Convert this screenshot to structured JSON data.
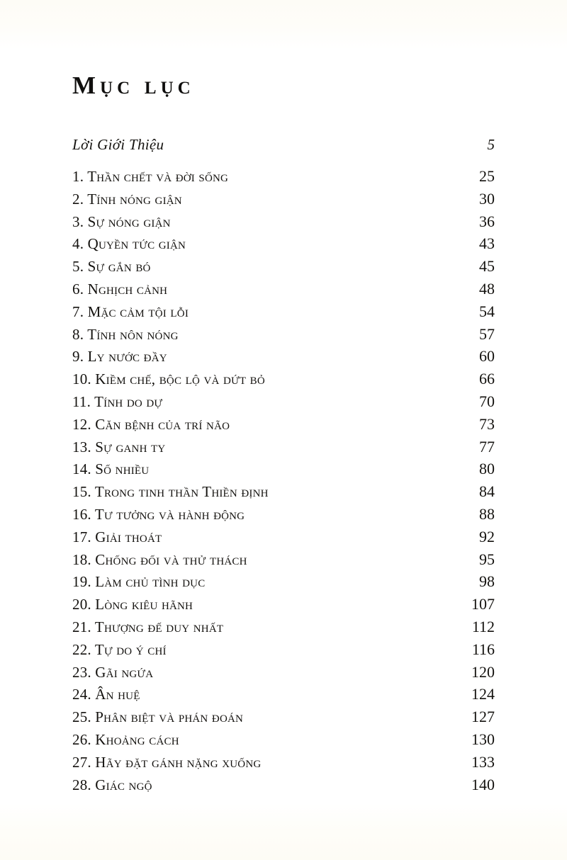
{
  "page": {
    "title": "Mục lục",
    "background_color": "#ffffff",
    "text_color": "#121110"
  },
  "toc": {
    "entries": [
      {
        "label": "Lời Giới Thiệu",
        "page": "5",
        "style": "italic"
      },
      {
        "label": "1. Thần chết và đời sống",
        "page": "25",
        "style": "small-caps"
      },
      {
        "label": "2. Tính nóng giận",
        "page": "30",
        "style": "small-caps"
      },
      {
        "label": "3. Sự nóng giận",
        "page": "36",
        "style": "small-caps"
      },
      {
        "label": "4. Quyền tức giận",
        "page": "43",
        "style": "small-caps"
      },
      {
        "label": "5. Sự gắn bó",
        "page": "45",
        "style": "small-caps"
      },
      {
        "label": "6. Nghịch cảnh",
        "page": "48",
        "style": "small-caps"
      },
      {
        "label": "7. Mặc cảm tội lỗi",
        "page": "54",
        "style": "small-caps"
      },
      {
        "label": "8. Tính nôn nóng",
        "page": "57",
        "style": "small-caps"
      },
      {
        "label": "9. Ly nước đầy",
        "page": "60",
        "style": "small-caps"
      },
      {
        "label": "10. Kiềm chế, bộc lộ và dứt bỏ",
        "page": "66",
        "style": "small-caps"
      },
      {
        "label": "11. Tính do dự",
        "page": "70",
        "style": "small-caps"
      },
      {
        "label": "12. Căn bệnh của trí não",
        "page": "73",
        "style": "small-caps"
      },
      {
        "label": "13. Sự ganh ty",
        "page": "77",
        "style": "small-caps"
      },
      {
        "label": "14. Số nhiều",
        "page": "80",
        "style": "small-caps"
      },
      {
        "label": "15. Trong tinh thần Thiền định",
        "page": "84",
        "style": "small-caps"
      },
      {
        "label": "16. Tư tưởng và hành động",
        "page": "88",
        "style": "small-caps"
      },
      {
        "label": "17. Giải thoát",
        "page": "92",
        "style": "small-caps"
      },
      {
        "label": "18. Chống đối và thử thách",
        "page": "95",
        "style": "small-caps"
      },
      {
        "label": "19. Làm chủ tình dục",
        "page": "98",
        "style": "small-caps"
      },
      {
        "label": "20. Lòng kiêu hãnh",
        "page": "107",
        "style": "small-caps"
      },
      {
        "label": "21. Thượng đế duy nhất",
        "page": "112",
        "style": "small-caps"
      },
      {
        "label": "22. Tự do ý chí",
        "page": "116",
        "style": "small-caps"
      },
      {
        "label": "23. Gãi ngứa",
        "page": "120",
        "style": "small-caps"
      },
      {
        "label": "24. Ân huệ",
        "page": "124",
        "style": "small-caps"
      },
      {
        "label": "25. Phân biệt và phán đoán",
        "page": "127",
        "style": "small-caps"
      },
      {
        "label": "26. Khoảng cách",
        "page": "130",
        "style": "small-caps"
      },
      {
        "label": "27. Hãy đặt gánh nặng xuống",
        "page": "133",
        "style": "small-caps"
      },
      {
        "label": "28. Giác ngộ",
        "page": "140",
        "style": "small-caps"
      }
    ]
  }
}
